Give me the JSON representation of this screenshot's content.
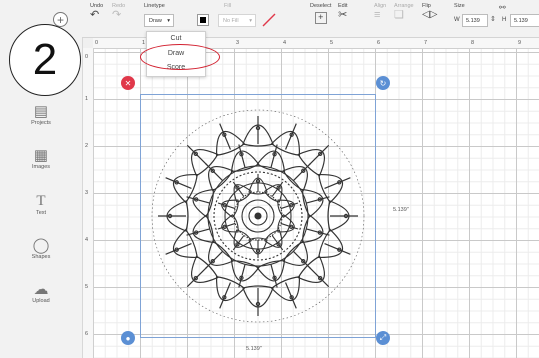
{
  "step": {
    "number": "2"
  },
  "toolbar": {
    "undo_label": "Undo",
    "redo_label": "Redo",
    "linetype_label": "Linetype",
    "linetype_value": "Draw",
    "fill_label": "Fill",
    "fill_value": "No Fill",
    "deselect_label": "Deselect",
    "edit_label": "Edit",
    "align_label": "Align",
    "arrange_label": "Arrange",
    "flip_label": "Flip",
    "size_label": "Size",
    "width_prefix": "W",
    "width_value": "5.139",
    "height_prefix": "H",
    "height_value": "5.139"
  },
  "linetype_menu": {
    "options": [
      "Cut",
      "Draw",
      "Score"
    ],
    "selected": "Draw"
  },
  "sidebar": {
    "items": [
      {
        "label": "Projects",
        "icon": "projects-icon"
      },
      {
        "label": "Images",
        "icon": "images-icon"
      },
      {
        "label": "Text",
        "icon": "text-icon"
      },
      {
        "label": "Shapes",
        "icon": "shapes-icon"
      },
      {
        "label": "Upload",
        "icon": "upload-icon"
      }
    ]
  },
  "ruler": {
    "top": [
      "0",
      "1",
      "2",
      "3",
      "4",
      "5",
      "6",
      "7",
      "8",
      "9"
    ],
    "left": [
      "0",
      "1",
      "2",
      "3",
      "4",
      "5",
      "6"
    ]
  },
  "selection": {
    "width_label": "5.139\"",
    "height_label": "5.139\""
  },
  "colors": {
    "accent": "#d2202f",
    "selection": "#7fa3d6",
    "handle_blue": "#5b8fd4",
    "handle_red": "#e0384a"
  }
}
